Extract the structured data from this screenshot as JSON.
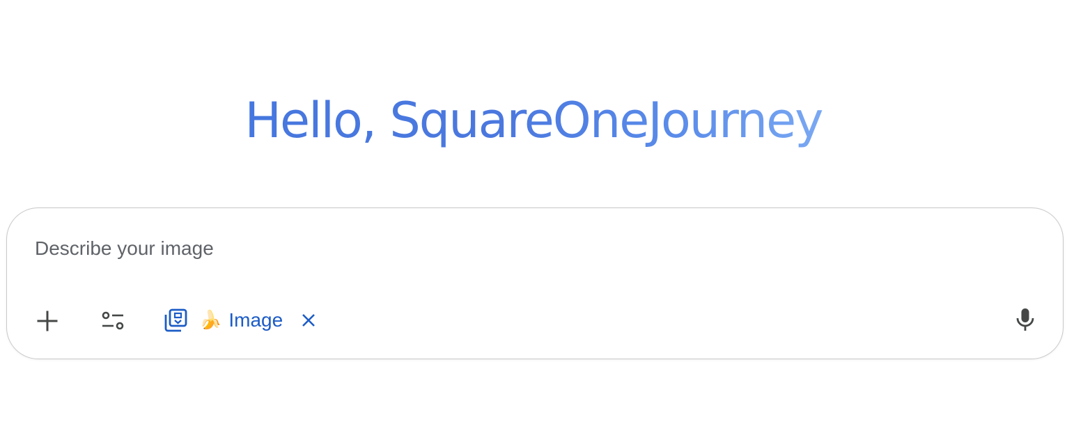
{
  "greeting": "Hello, SquareOneJourney",
  "composer": {
    "placeholder": "Describe your image",
    "toolbar": {
      "add_icon": "plus-icon",
      "tools_icon": "tune-icon",
      "mic_icon": "microphone-icon"
    },
    "chip": {
      "icon": "image-gallery-icon",
      "emoji": "🍌",
      "label": "Image",
      "close_icon": "close-icon"
    }
  },
  "colors": {
    "greeting": "#4a7fe0",
    "chip": "#1c5cc6",
    "icon": "#444746",
    "border": "#c8c8c8"
  }
}
